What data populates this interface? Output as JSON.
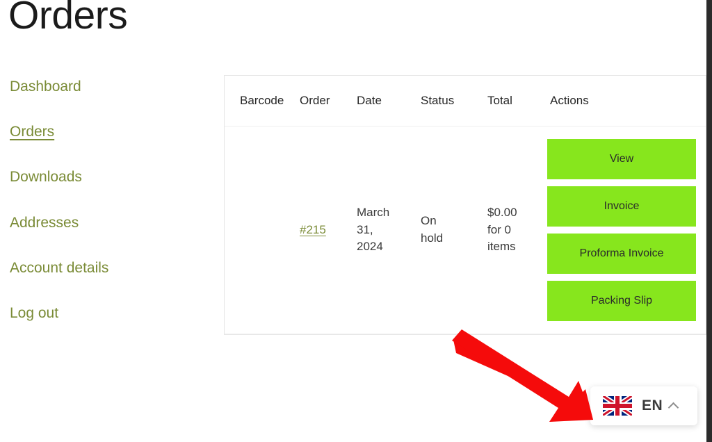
{
  "page": {
    "title": "Orders"
  },
  "sidebar": {
    "items": [
      {
        "label": "Dashboard",
        "active": false
      },
      {
        "label": "Orders",
        "active": true
      },
      {
        "label": "Downloads",
        "active": false
      },
      {
        "label": "Addresses",
        "active": false
      },
      {
        "label": "Account details",
        "active": false
      },
      {
        "label": "Log out",
        "active": false
      }
    ]
  },
  "orders_table": {
    "columns": [
      "Barcode",
      "Order",
      "Date",
      "Status",
      "Total",
      "Actions"
    ],
    "rows": [
      {
        "barcode": "",
        "order": "#215",
        "date_lines": [
          "March",
          "31,",
          "2024"
        ],
        "status_lines": [
          "On",
          "hold"
        ],
        "total_lines": [
          "$0.00",
          "for 0",
          "items"
        ],
        "actions": [
          "View",
          "Invoice",
          "Proforma Invoice",
          "Packing Slip"
        ]
      }
    ]
  },
  "language_switcher": {
    "flag_icon": "uk-flag-icon",
    "code": "EN",
    "chevron_icon": "chevron-up-icon"
  },
  "annotation": {
    "arrow_icon": "red-arrow-icon",
    "arrow_color": "#f50b0b"
  },
  "colors": {
    "accent_green": "#87e61d",
    "link_olive": "#7a8b36",
    "border_grey": "#e6e6e6",
    "text_dark": "#1b1b1b"
  }
}
